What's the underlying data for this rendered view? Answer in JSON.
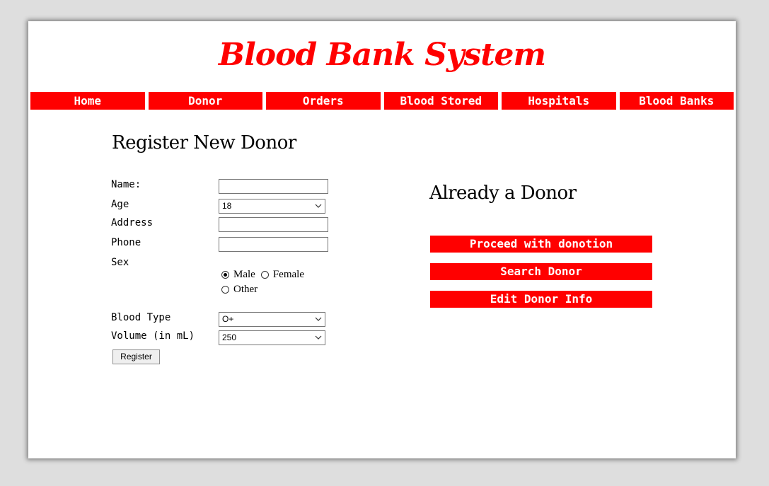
{
  "header": {
    "title": "Blood Bank System"
  },
  "nav": {
    "items": [
      "Home",
      "Donor",
      "Orders",
      "Blood Stored",
      "Hospitals",
      "Blood Banks"
    ]
  },
  "register": {
    "heading": "Register New Donor",
    "name_label": "Name:",
    "name_value": "",
    "age_label": "Age",
    "age_value": "18",
    "address_label": "Address",
    "address_value": "",
    "phone_label": "Phone",
    "phone_value": "",
    "sex_label": "Sex",
    "sex_options": [
      "Male",
      "Female",
      "Other"
    ],
    "sex_selected": "Male",
    "blood_type_label": "Blood Type",
    "blood_type_value": "O+",
    "volume_label": "Volume (in mL)",
    "volume_value": "250",
    "submit_label": "Register"
  },
  "existing": {
    "heading": "Already a Donor",
    "actions": [
      "Proceed with donotion",
      "Search Donor",
      "Edit Donor Info"
    ]
  },
  "colors": {
    "brand": "#ff0000",
    "page_background": "#dedede",
    "card_background": "#ffffff"
  }
}
